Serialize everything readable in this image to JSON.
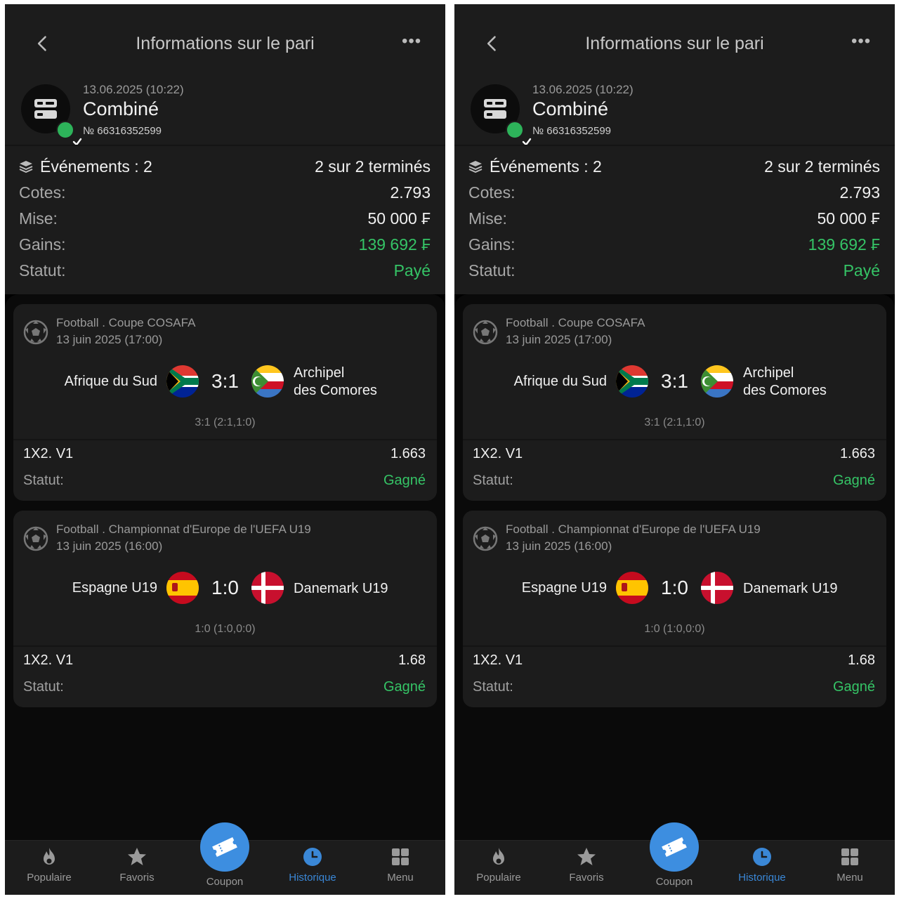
{
  "screen": {
    "title": "Informations sur le pari",
    "more": "•••",
    "bet": {
      "date": "13.06.2025 (10:22)",
      "type": "Combiné",
      "number": "№ 66316352599"
    },
    "summary": {
      "events_label": "Événements : 2",
      "events_value": "2 sur 2 terminés",
      "odds_label": "Cotes:",
      "odds_value": "2.793",
      "stake_label": "Mise:",
      "stake_value": "50 000 ₣",
      "winnings_label": "Gains:",
      "winnings_value": "139 692 ₣",
      "status_label": "Statut:",
      "status_value": "Payé"
    },
    "events": [
      {
        "league": "Football . Coupe COSAFA",
        "date": "13 juin 2025 (17:00)",
        "team1": "Afrique du Sud",
        "team2_line1": "Archipel",
        "team2_line2": "des Comores",
        "score": "3:1",
        "detail": "3:1 (2:1,1:0)",
        "market": "1X2. V1",
        "odd": "1.663",
        "status_label": "Statut:",
        "status_value": "Gagné"
      },
      {
        "league": "Football . Championnat d'Europe de l'UEFA U19",
        "date": "13 juin 2025 (16:00)",
        "team1": "Espagne U19",
        "team2": "Danemark U19",
        "score": "1:0",
        "detail": "1:0 (1:0,0:0)",
        "market": "1X2. V1",
        "odd": "1.68",
        "status_label": "Statut:",
        "status_value": "Gagné"
      }
    ],
    "tabs": {
      "popular": "Populaire",
      "favorites": "Favoris",
      "coupon": "Coupon",
      "history": "Historique",
      "menu": "Menu"
    }
  },
  "colors": {
    "accent_blue": "#3d8ee0",
    "win_green": "#35c466",
    "background": "#1c1c1c"
  }
}
